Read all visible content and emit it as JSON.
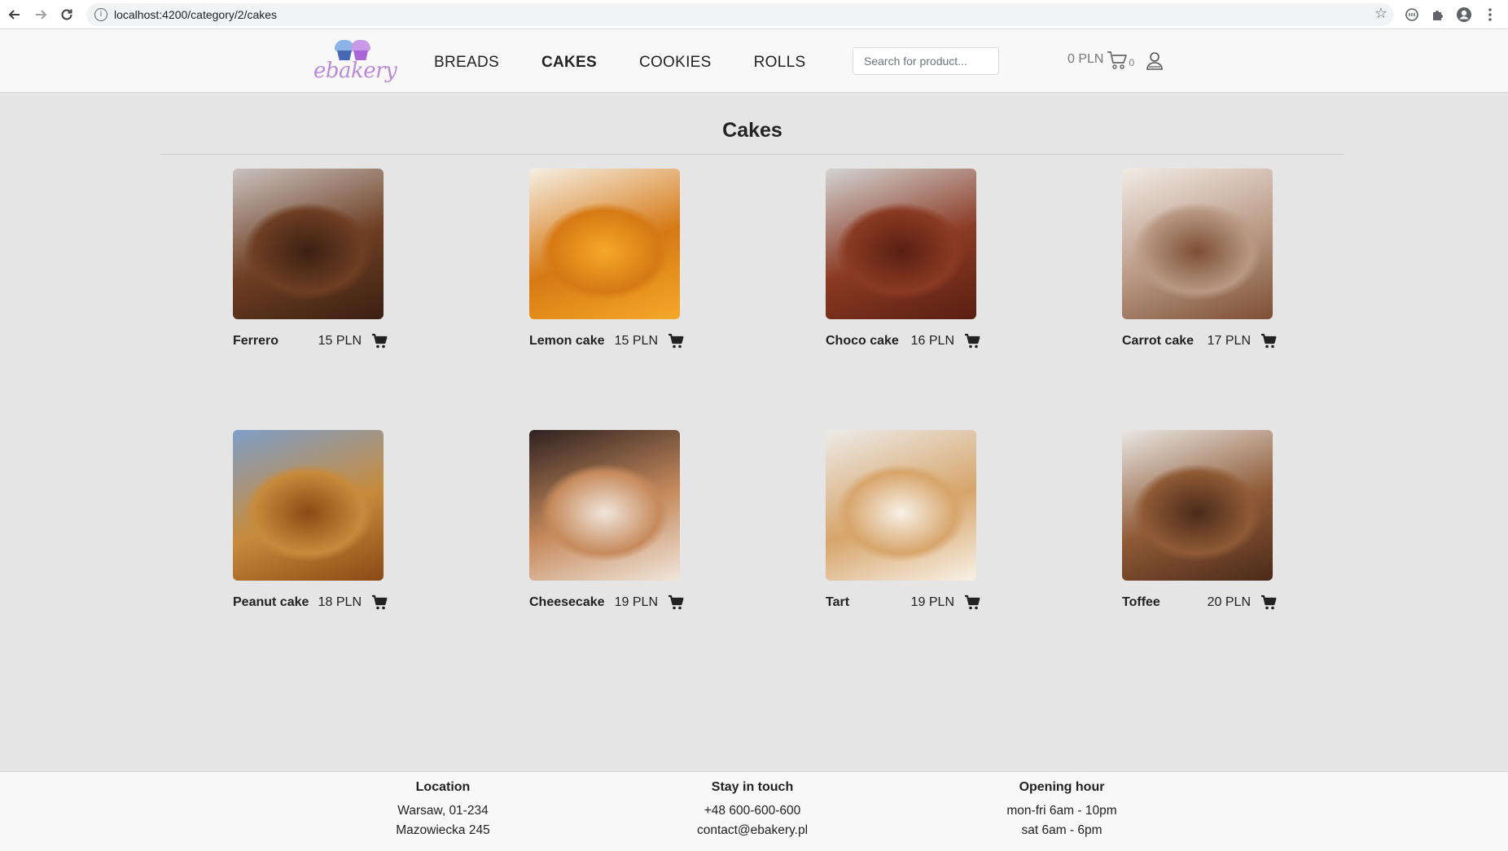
{
  "browser": {
    "url": "localhost:4200/category/2/cakes"
  },
  "header": {
    "logo_text": "ebakery",
    "nav": [
      {
        "label": "BREADS",
        "active": false
      },
      {
        "label": "CAKES",
        "active": true
      },
      {
        "label": "COOKIES",
        "active": false
      },
      {
        "label": "ROLLS",
        "active": false
      }
    ],
    "search_placeholder": "Search for product...",
    "cart_total": "0 PLN",
    "cart_count": "0"
  },
  "page": {
    "title": "Cakes"
  },
  "products": [
    {
      "name": "Ferrero",
      "price": "15 PLN",
      "colors": [
        "#3b2013",
        "#6e3e22",
        "#c9c2bf"
      ]
    },
    {
      "name": "Lemon cake",
      "price": "15 PLN",
      "colors": [
        "#f4a928",
        "#d67914",
        "#f6efe3"
      ]
    },
    {
      "name": "Choco cake",
      "price": "16 PLN",
      "colors": [
        "#5a1f12",
        "#8a3a22",
        "#d4d4d4"
      ]
    },
    {
      "name": "Carrot cake",
      "price": "17 PLN",
      "colors": [
        "#7c4f33",
        "#b99884",
        "#f1ebe5"
      ]
    },
    {
      "name": "Peanut cake",
      "price": "18 PLN",
      "colors": [
        "#8a4a14",
        "#c78b3c",
        "#7f9fca"
      ]
    },
    {
      "name": "Cheesecake",
      "price": "19 PLN",
      "colors": [
        "#f0e6dc",
        "#c68a5c",
        "#2e2120"
      ]
    },
    {
      "name": "Tart",
      "price": "19 PLN",
      "colors": [
        "#f8f1e7",
        "#d7a56b",
        "#ecebe8"
      ]
    },
    {
      "name": "Toffee",
      "price": "20 PLN",
      "colors": [
        "#4b2a1a",
        "#8f5a35",
        "#e9e7e4"
      ]
    }
  ],
  "footer": {
    "location": {
      "heading": "Location",
      "line1": "Warsaw, 01-234",
      "line2": "Mazowiecka 245"
    },
    "contact": {
      "heading": "Stay in touch",
      "line1": "+48 600-600-600",
      "line2": "contact@ebakery.pl"
    },
    "hours": {
      "heading": "Opening hour",
      "line1": "mon-fri 6am - 10pm",
      "line2": "sat 6am - 6pm"
    }
  }
}
